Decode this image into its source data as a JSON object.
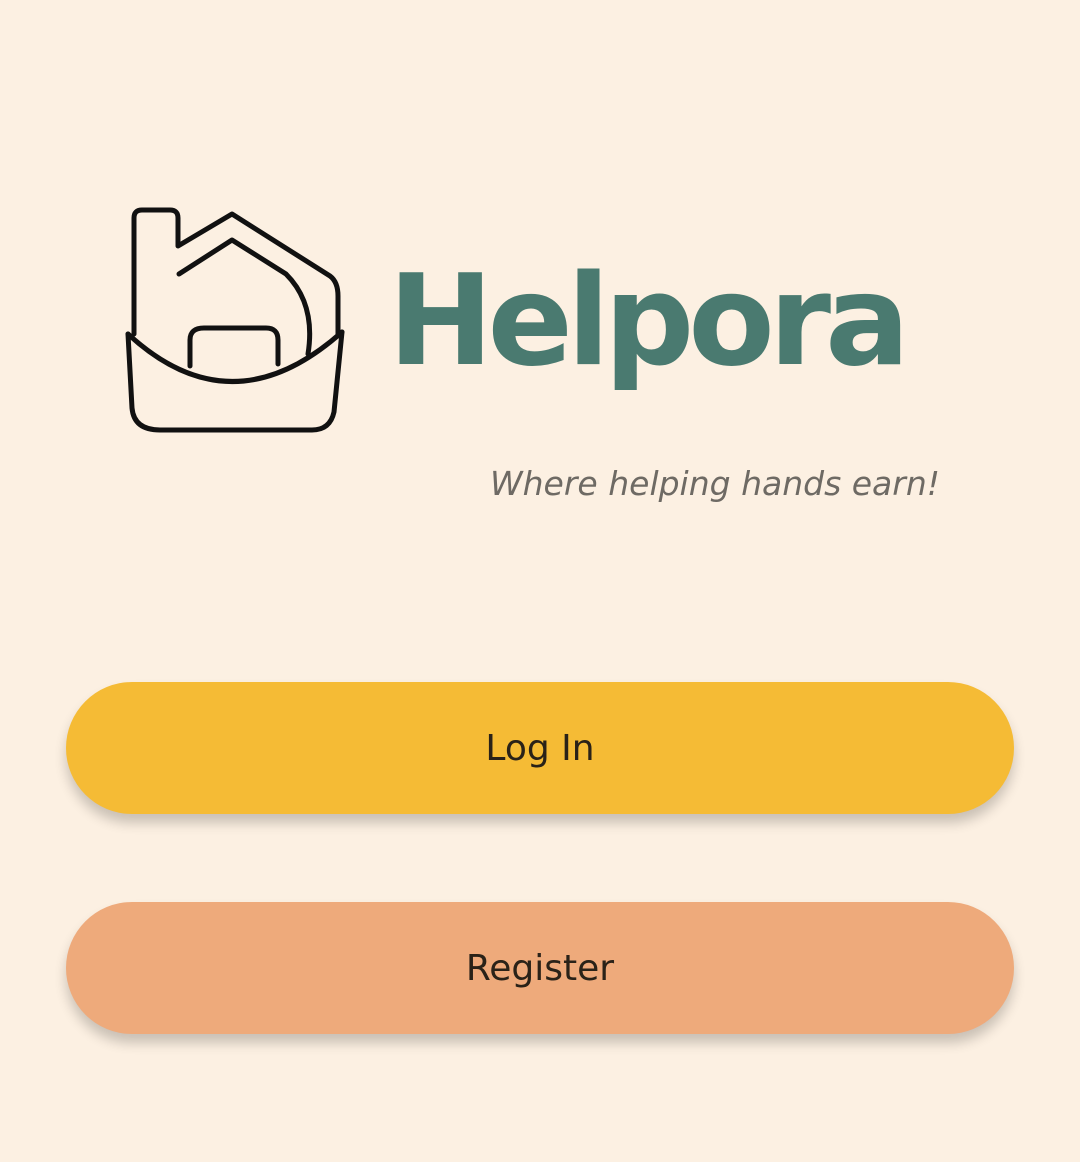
{
  "brand": {
    "name": "Helpora",
    "tagline": "Where helping hands earn!",
    "logo_icon": "house-basket-icon",
    "color": "#4a7a70"
  },
  "actions": {
    "login": {
      "label": "Log In",
      "color": "#f5bb35"
    },
    "register": {
      "label": "Register",
      "color": "#eeaa7b"
    }
  },
  "theme": {
    "background": "#fcf0e2",
    "tagline_color": "#6e6a64",
    "text_color": "#2a2218"
  }
}
